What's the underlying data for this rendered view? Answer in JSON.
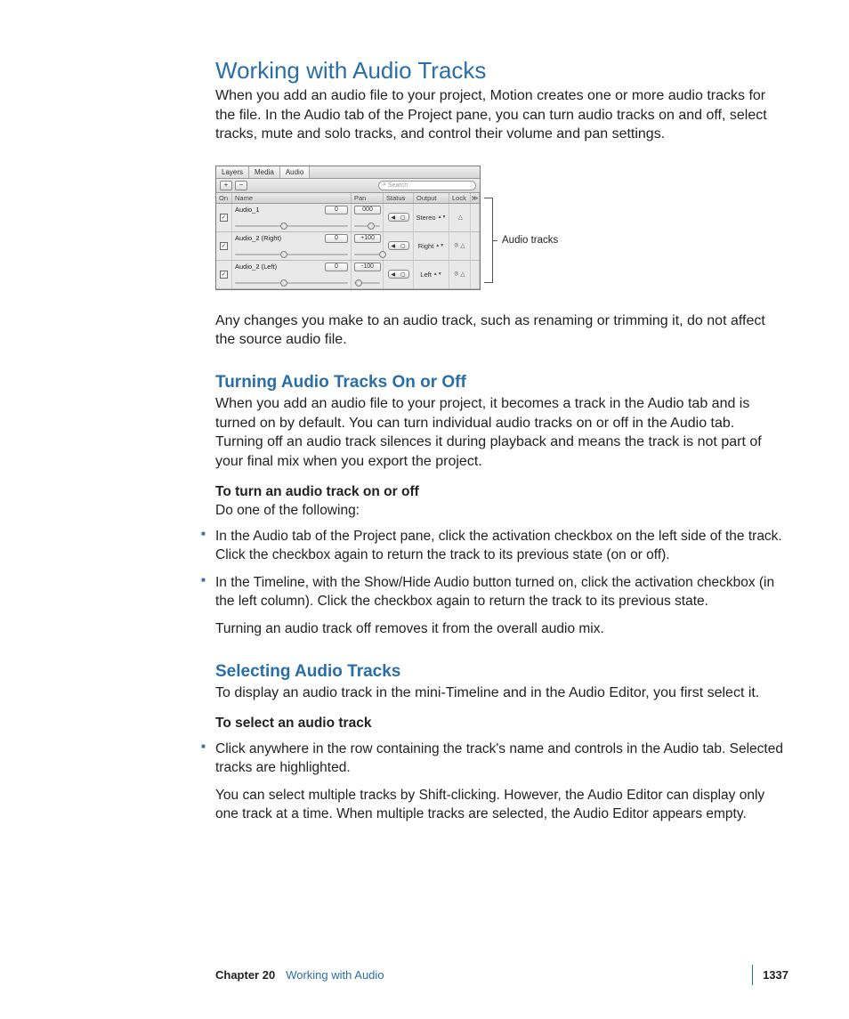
{
  "heading": "Working with Audio Tracks",
  "intro": "When you add an audio file to your project, Motion creates one or more audio tracks for the file. In the Audio tab of the Project pane, you can turn audio tracks on and off, select tracks, mute and solo tracks, and control their volume and pan settings.",
  "panel": {
    "tabs": {
      "layers": "Layers",
      "media": "Media",
      "audio": "Audio"
    },
    "toolbar": {
      "plus": "+",
      "minus": "−",
      "search_icon": "⌕",
      "search_placeholder": "Search"
    },
    "columns": {
      "on": "On",
      "name": "Name",
      "pan": "Pan",
      "status": "Status",
      "output": "Output",
      "lock": "Lock",
      "end": "≫"
    },
    "tracks": [
      {
        "name": "Audio_1",
        "level": "0",
        "pan": "000",
        "output": "Stereo",
        "link": "",
        "pan_thumb": 50
      },
      {
        "name": "Audio_2 (Right)",
        "level": "0",
        "pan": "+100",
        "output": "Right",
        "link": "⦻",
        "pan_thumb": 95
      },
      {
        "name": "Audio_2 (Left)",
        "level": "0",
        "pan": "-100",
        "output": "Left",
        "link": "⦻",
        "pan_thumb": 5
      }
    ],
    "check": "✓",
    "mute_icon": "◀",
    "solo_icon": "▢",
    "lock_icon": "△"
  },
  "callout": "Audio tracks",
  "after_figure": "Any changes you make to an audio track, such as renaming or trimming it, do not affect the source audio file.",
  "section1": {
    "title": "Turning Audio Tracks On or Off",
    "body": "When you add an audio file to your project, it becomes a track in the Audio tab and is turned on by default. You can turn individual audio tracks on or off in the Audio tab. Turning off an audio track silences it during playback and means the track is not part of your final mix when you export the project.",
    "instr_bold": "To turn an audio track on or off",
    "instr_rest": "Do one of the following:",
    "bullets": [
      "In the Audio tab of the Project pane, click the activation checkbox on the left side of the track. Click the checkbox again to return the track to its previous state (on or off).",
      "In the Timeline, with the Show/Hide Audio button turned on, click the activation checkbox (in the left column). Click the checkbox again to return the track to its previous state."
    ],
    "after": "Turning an audio track off removes it from the overall audio mix."
  },
  "section2": {
    "title": "Selecting Audio Tracks",
    "body": "To display an audio track in the mini-Timeline and in the Audio Editor, you first select it.",
    "instr_bold": "To select an audio track",
    "bullets": [
      "Click anywhere in the row containing the track's name and controls in the Audio tab. Selected tracks are highlighted."
    ],
    "after": "You can select multiple tracks by Shift-clicking. However, the Audio Editor can display only one track at a time. When multiple tracks are selected, the Audio Editor appears empty."
  },
  "footer": {
    "chapter": "Chapter 20",
    "title": "Working with Audio",
    "page": "1337"
  }
}
